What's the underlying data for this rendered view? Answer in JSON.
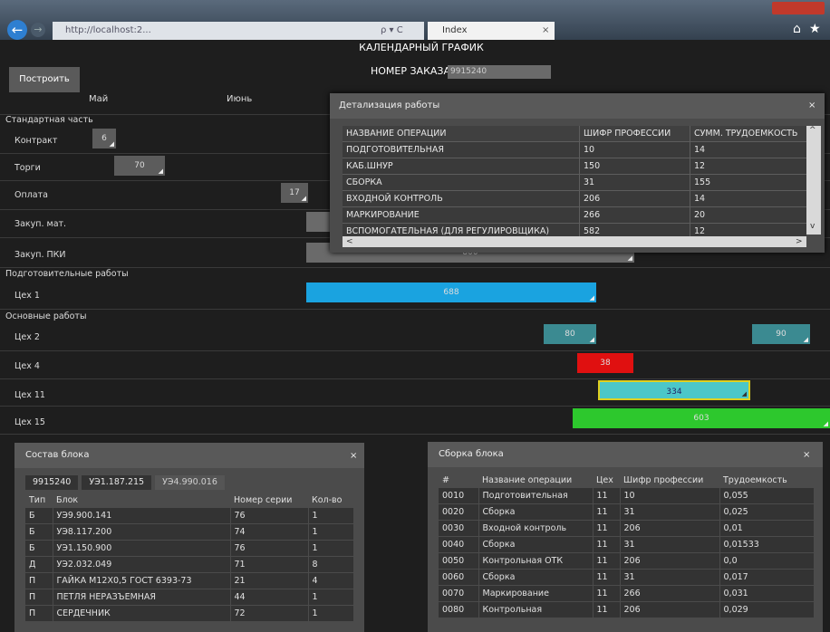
{
  "browser": {
    "address": "http://localhost:2...",
    "address_controls": "ρ ▾ C",
    "tab_label": "Index",
    "tab_close": "×",
    "back": "←",
    "forward": "→",
    "home": "⌂",
    "star": "★"
  },
  "page": {
    "title": "КАЛЕНДАРНЫЙ ГРАФИК",
    "build_button": "Построить",
    "order_label": "НОМЕР ЗАКАЗА",
    "order_value": "9915240",
    "months": [
      "Май",
      "Июнь"
    ]
  },
  "gantt": {
    "sections": {
      "standard": "Стандартная часть",
      "prep": "Подготовительные работы",
      "main": "Основные работы"
    },
    "rows": [
      {
        "label": "Контракт",
        "bar": "6"
      },
      {
        "label": "Торги",
        "bar": "70"
      },
      {
        "label": "Оплата",
        "bar": "17"
      },
      {
        "label": "Закуп. мат.",
        "bar": ""
      },
      {
        "label": "Закуп. ПКИ",
        "bar": "800"
      },
      {
        "label": "Цех 1",
        "bar": "688"
      },
      {
        "label": "Цех 2",
        "bar": "80",
        "bar2": "90"
      },
      {
        "label": "Цех 4",
        "bar": "38"
      },
      {
        "label": "Цех 11",
        "bar": "334"
      },
      {
        "label": "Цех 15",
        "bar": "603"
      }
    ],
    "grip": "◢"
  },
  "detail": {
    "title": "Детализация работы",
    "close": "×",
    "headers": [
      "НАЗВАНИЕ ОПЕРАЦИИ",
      "ШИФР ПРОФЕССИИ",
      "СУММ. ТРУДОЕМКОСТЬ"
    ],
    "rows": [
      [
        "ПОДГОТОВИТЕЛЬНАЯ",
        "10",
        "14"
      ],
      [
        "КАБ.ШНУР",
        "150",
        "12"
      ],
      [
        "СБОРКА",
        "31",
        "155"
      ],
      [
        "ВХОДНОЙ КОНТРОЛЬ",
        "206",
        "14"
      ],
      [
        "МАРКИРОВАНИЕ",
        "266",
        "20"
      ],
      [
        "ВСПОМОГАТЕЛЬНАЯ (ДЛЯ РЕГУЛИРОВЩИКА)",
        "582",
        "12"
      ]
    ],
    "scroll_left": "<",
    "scroll_right": ">",
    "scroll_up": "^",
    "scroll_down": "v"
  },
  "block": {
    "title": "Состав блока",
    "close": "×",
    "crumbs": [
      "9915240",
      "УЭ1.187.215",
      "УЭ4.990.016"
    ],
    "headers": [
      "Тип",
      "Блок",
      "Номер серии",
      "Кол-во"
    ],
    "rows": [
      [
        "Б",
        "УЭ9.900.141",
        "76",
        "1"
      ],
      [
        "Б",
        "УЭ8.117.200",
        "74",
        "1"
      ],
      [
        "Б",
        "УЭ1.150.900",
        "76",
        "1"
      ],
      [
        "Д",
        "УЭ2.032.049",
        "71",
        "8"
      ],
      [
        "П",
        "ГАЙКА М12Х0,5 ГОСТ 6393-73",
        "21",
        "4"
      ],
      [
        "П",
        "ПЕТЛЯ НЕРАЗЪЕМНАЯ",
        "44",
        "1"
      ],
      [
        "П",
        "СЕРДЕЧНИК",
        "72",
        "1"
      ]
    ]
  },
  "assembly": {
    "title": "Сборка блока",
    "close": "×",
    "headers": [
      "#",
      "Название операции",
      "Цех",
      "Шифр профессии",
      "Трудоемкость"
    ],
    "rows": [
      [
        "0010",
        "Подготовительная",
        "11",
        "10",
        "0,055"
      ],
      [
        "0020",
        "Сборка",
        "11",
        "31",
        "0,025"
      ],
      [
        "0030",
        "Входной контроль",
        "11",
        "206",
        "0,01"
      ],
      [
        "0040",
        "Сборка",
        "11",
        "31",
        "0,01533"
      ],
      [
        "0050",
        "Контрольная ОТК",
        "11",
        "206",
        "0,0"
      ],
      [
        "0060",
        "Сборка",
        "11",
        "31",
        "0,017"
      ],
      [
        "0070",
        "Маркирование",
        "11",
        "266",
        "0,031"
      ],
      [
        "0080",
        "Контрольная",
        "11",
        "206",
        "0,029"
      ]
    ]
  }
}
